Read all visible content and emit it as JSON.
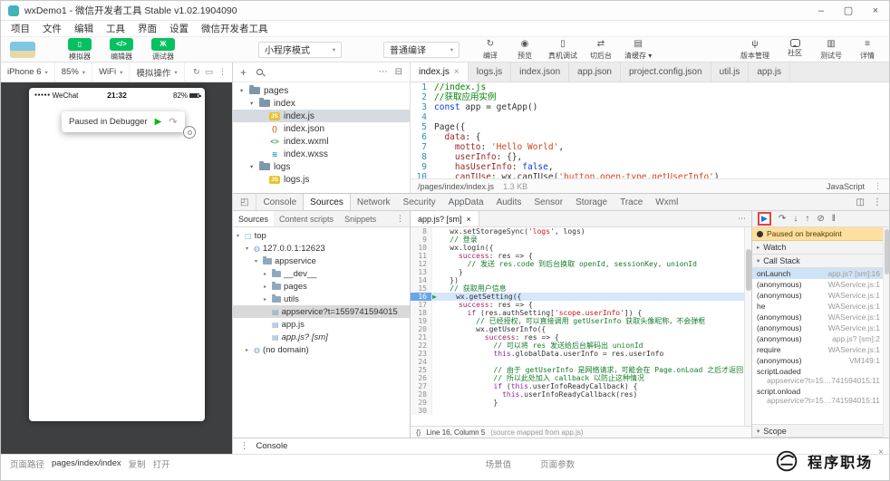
{
  "colors": {
    "wechat_green": "#07c160",
    "devtools_blue": "#1a73e8",
    "annotation_red": "#e04343",
    "paused_banner": "#ffdf9e",
    "selection_blue": "#d6e6fb"
  },
  "window": {
    "title": "wxDemo1 - 微信开发者工具 Stable v1.02.1904090",
    "controls": [
      {
        "name": "minimize-button",
        "glyph": "–"
      },
      {
        "name": "maximize-button",
        "glyph": "▢"
      },
      {
        "name": "close-button",
        "glyph": "×"
      }
    ]
  },
  "menubar": [
    "项目",
    "文件",
    "编辑",
    "工具",
    "界面",
    "设置",
    "微信开发者工具"
  ],
  "toolbar": {
    "modes": [
      {
        "label": "模拟器",
        "icon": "simulator-icon",
        "glyph": "▯"
      },
      {
        "label": "编辑器",
        "icon": "code-icon",
        "glyph": "</>"
      },
      {
        "label": "调试器",
        "icon": "debugger-bug-icon",
        "glyph": "Ж"
      }
    ],
    "mode_select": "小程序模式",
    "compile_select": "普通编译",
    "caret": "▾",
    "actions": [
      {
        "label": "编译",
        "icon": "compile-icon",
        "glyph": "↻"
      },
      {
        "label": "预览",
        "icon": "preview-eye-icon",
        "glyph": "◉"
      },
      {
        "label": "真机调试",
        "icon": "remote-debug-icon",
        "glyph": "▯"
      },
      {
        "label": "切后台",
        "icon": "switch-background-icon",
        "glyph": "⇄"
      },
      {
        "label": "清缓存",
        "icon": "clear-cache-icon",
        "glyph": "▤",
        "dropdown": true
      }
    ],
    "right_actions": [
      {
        "label": "版本管理",
        "icon": "version-control-icon",
        "glyph": "ψ"
      },
      {
        "label": "社区",
        "icon": "community-chat-icon",
        "glyph": "",
        "css": "ico-bubble"
      },
      {
        "label": "测试号",
        "icon": "test-account-icon",
        "glyph": "▥"
      },
      {
        "label": "详情",
        "icon": "details-icon",
        "glyph": "≡"
      }
    ]
  },
  "device_bar": {
    "items": [
      {
        "label": "iPhone 6"
      },
      {
        "label": "85%"
      },
      {
        "label": "WiFi"
      },
      {
        "label": "模拟操作"
      }
    ],
    "caret": "▾",
    "icons": [
      {
        "name": "rotate-icon",
        "glyph": "↻"
      },
      {
        "name": "screenshot-icon",
        "glyph": "▭"
      },
      {
        "name": "more-icon",
        "glyph": "⋮"
      }
    ]
  },
  "simulator": {
    "carrier_dots": "●●●●●",
    "carrier": "WeChat",
    "time": "21:32",
    "battery": "82%",
    "tooltip": {
      "text": "Paused in Debugger",
      "resume_glyph": "▶",
      "step_glyph": "↷"
    }
  },
  "file_explorer": {
    "toolbar_left": [
      {
        "name": "add-file-icon",
        "glyph": "+"
      },
      {
        "name": "search-files-icon",
        "glyph": "",
        "css": "ico-search"
      }
    ],
    "toolbar_right": [
      {
        "name": "more-actions-icon",
        "glyph": "⋯"
      },
      {
        "name": "collapse-all-icon",
        "glyph": "⊟"
      }
    ],
    "tree": [
      {
        "kind": "folder",
        "depth": 0,
        "name": "pages"
      },
      {
        "kind": "folder",
        "depth": 1,
        "name": "index"
      },
      {
        "kind": "file",
        "depth": 2,
        "name": "index.js",
        "badge": "JS",
        "badge_bg": "#e9c231",
        "badge_fg": "#ffffff",
        "selected": true
      },
      {
        "kind": "file",
        "depth": 2,
        "name": "index.json",
        "badge": "{}",
        "badge_fg": "#d68a3a"
      },
      {
        "kind": "file",
        "depth": 2,
        "name": "index.wxml",
        "badge": "<>",
        "badge_fg": "#3a9e63"
      },
      {
        "kind": "file",
        "depth": 2,
        "name": "index.wxss",
        "badge": "≋",
        "badge_fg": "#189ab4"
      },
      {
        "kind": "folder",
        "depth": 1,
        "name": "logs"
      },
      {
        "kind": "file",
        "depth": 2,
        "name": "logs.js",
        "badge": "JS",
        "badge_bg": "#e9c231",
        "badge_fg": "#ffffff"
      }
    ]
  },
  "editor": {
    "tabs": [
      {
        "label": "index.js",
        "active": true,
        "close": "×"
      },
      {
        "label": "logs.js"
      },
      {
        "label": "index.json"
      },
      {
        "label": "app.json"
      },
      {
        "label": "project.config.json"
      },
      {
        "label": "util.js"
      },
      {
        "label": "app.js"
      }
    ],
    "lines": [
      {
        "n": 1,
        "t": [
          [
            "c",
            "//index.js"
          ]
        ]
      },
      {
        "n": 2,
        "t": [
          [
            "c",
            "//获取应用实例"
          ]
        ]
      },
      {
        "n": 3,
        "t": [
          [
            "k",
            "const"
          ],
          [
            "x",
            " app = getApp()"
          ]
        ]
      },
      {
        "n": 4,
        "t": []
      },
      {
        "n": 5,
        "t": [
          [
            "x",
            "Page({"
          ]
        ]
      },
      {
        "n": 6,
        "t": [
          [
            "x",
            "  "
          ],
          [
            "p",
            "data"
          ],
          [
            "x",
            ": {"
          ]
        ]
      },
      {
        "n": 7,
        "t": [
          [
            "x",
            "    "
          ],
          [
            "p",
            "motto"
          ],
          [
            "x",
            ": "
          ],
          [
            "s",
            "'Hello World'"
          ],
          [
            "x",
            ","
          ]
        ]
      },
      {
        "n": 8,
        "t": [
          [
            "x",
            "    "
          ],
          [
            "p",
            "userInfo"
          ],
          [
            "x",
            ": {},"
          ]
        ]
      },
      {
        "n": 9,
        "t": [
          [
            "x",
            "    "
          ],
          [
            "p",
            "hasUserInfo"
          ],
          [
            "x",
            ": "
          ],
          [
            "k",
            "false"
          ],
          [
            "x",
            ","
          ]
        ]
      },
      {
        "n": 10,
        "t": [
          [
            "x",
            "    "
          ],
          [
            "p",
            "canIUse"
          ],
          [
            "x",
            ": wx.canIUse("
          ],
          [
            "s",
            "'button.open-type.getUserInfo'"
          ],
          [
            "x",
            ")"
          ]
        ]
      }
    ],
    "status": {
      "path": "/pages/index/index.js",
      "size": "1.3 KB",
      "language": "JavaScript",
      "menu_glyph": "⋮"
    }
  },
  "devtools": {
    "inspect_glyph": "◰",
    "tabs": [
      {
        "label": "Console"
      },
      {
        "label": "Sources",
        "active": true
      },
      {
        "label": "Network"
      },
      {
        "label": "Security"
      },
      {
        "label": "AppData"
      },
      {
        "label": "Audits"
      },
      {
        "label": "Sensor"
      },
      {
        "label": "Storage"
      },
      {
        "label": "Trace"
      },
      {
        "label": "Wxml"
      }
    ],
    "right_icons": [
      {
        "name": "dock-side-icon",
        "glyph": "◫"
      },
      {
        "name": "devtools-menu-icon",
        "glyph": "⋮"
      }
    ],
    "sources_tabs": [
      {
        "label": "Sources",
        "active": true
      },
      {
        "label": "Content scripts"
      },
      {
        "label": "Snippets"
      }
    ],
    "sources_menu_glyph": "⋮",
    "tree": [
      {
        "depth": 0,
        "arrow": "▾",
        "icon": "frame-icon",
        "glyph": "▢",
        "name": "top"
      },
      {
        "depth": 1,
        "arrow": "▾",
        "icon": "origin-globe-icon",
        "glyph": "◍",
        "name": "127.0.0.1:12623"
      },
      {
        "depth": 2,
        "arrow": "▾",
        "icon": "folder-icon",
        "name": "appservice"
      },
      {
        "depth": 3,
        "arrow": "▸",
        "icon": "folder-icon",
        "name": "__dev__"
      },
      {
        "depth": 3,
        "arrow": "▸",
        "icon": "folder-icon",
        "name": "pages"
      },
      {
        "depth": 3,
        "arrow": "▸",
        "icon": "folder-icon",
        "name": "utils"
      },
      {
        "depth": 3,
        "icon": "file-icon",
        "glyph": "▤",
        "name": "appservice?t=1559741594015",
        "selected": true
      },
      {
        "depth": 3,
        "icon": "file-icon",
        "glyph": "▤",
        "name": "app.js"
      },
      {
        "depth": 3,
        "icon": "file-icon",
        "glyph": "▤",
        "name": "app.js? [sm]",
        "italic": true
      },
      {
        "depth": 1,
        "arrow": "▸",
        "icon": "origin-globe-icon",
        "glyph": "◍",
        "name": "(no domain)"
      }
    ],
    "editor_tab": {
      "label": "app.js? [sm]",
      "close": "×",
      "menu_glyph": "⋯"
    },
    "code_lines": [
      {
        "n": 8,
        "t": [
          [
            "x",
            "    wx.setStorageSync("
          ],
          [
            "s",
            "'logs'"
          ],
          [
            "x",
            ", logs)"
          ]
        ]
      },
      {
        "n": 9,
        "t": [
          [
            "c",
            "    // 登录"
          ]
        ]
      },
      {
        "n": 10,
        "t": [
          [
            "x",
            "    wx.login({"
          ]
        ]
      },
      {
        "n": 11,
        "t": [
          [
            "x",
            "      "
          ],
          [
            "p",
            "success"
          ],
          [
            "x",
            ": res => {"
          ]
        ]
      },
      {
        "n": 12,
        "t": [
          [
            "c",
            "        // 发送 res.code 到后台换取 openId, sessionKey, unionId"
          ]
        ]
      },
      {
        "n": 13,
        "t": [
          [
            "x",
            "      }"
          ]
        ]
      },
      {
        "n": 14,
        "t": [
          [
            "x",
            "    })"
          ]
        ]
      },
      {
        "n": 15,
        "t": [
          [
            "c",
            "    // 获取用户信息"
          ]
        ]
      },
      {
        "n": 16,
        "cur": true,
        "t": [
          [
            "x",
            "    wx.getSetting({"
          ]
        ]
      },
      {
        "n": 17,
        "t": [
          [
            "x",
            "      "
          ],
          [
            "p",
            "success"
          ],
          [
            "x",
            ": res => {"
          ]
        ]
      },
      {
        "n": 18,
        "t": [
          [
            "x",
            "        "
          ],
          [
            "k",
            "if"
          ],
          [
            "x",
            " (res.authSetting["
          ],
          [
            "s",
            "'scope.userInfo'"
          ],
          [
            "x",
            "]) {"
          ]
        ]
      },
      {
        "n": 19,
        "t": [
          [
            "c",
            "          // 已经授权，可以直接调用 getUserInfo 获取头像昵称，不会弹框"
          ]
        ]
      },
      {
        "n": 20,
        "t": [
          [
            "x",
            "          wx.getUserInfo({"
          ]
        ]
      },
      {
        "n": 21,
        "t": [
          [
            "x",
            "            "
          ],
          [
            "p",
            "success"
          ],
          [
            "x",
            ": res => {"
          ]
        ]
      },
      {
        "n": 22,
        "t": [
          [
            "c",
            "              // 可以将 res 发送给后台解码出 unionId"
          ]
        ]
      },
      {
        "n": 23,
        "t": [
          [
            "x",
            "              "
          ],
          [
            "k",
            "this"
          ],
          [
            "x",
            ".globalData.userInfo = res.userInfo"
          ]
        ]
      },
      {
        "n": 24,
        "t": []
      },
      {
        "n": 25,
        "t": [
          [
            "c",
            "              // 由于 getUserInfo 是网络请求，可能会在 Page.onLoad 之后才返回"
          ]
        ]
      },
      {
        "n": 26,
        "t": [
          [
            "c",
            "              // 所以此处加入 callback 以防止这种情况"
          ]
        ]
      },
      {
        "n": 27,
        "t": [
          [
            "x",
            "              "
          ],
          [
            "k",
            "if"
          ],
          [
            "x",
            " ("
          ],
          [
            "k",
            "this"
          ],
          [
            "x",
            ".userInfoReadyCallback) {"
          ]
        ]
      },
      {
        "n": 28,
        "t": [
          [
            "x",
            "                "
          ],
          [
            "k",
            "this"
          ],
          [
            "x",
            ".userInfoReadyCallback(res)"
          ]
        ]
      },
      {
        "n": 29,
        "t": [
          [
            "x",
            "              }"
          ]
        ]
      },
      {
        "n": 30,
        "t": []
      }
    ],
    "code_status": {
      "braces": "{}",
      "line_col": "Line 16, Column 5",
      "mapped": "(source mapped from app.js)"
    },
    "debug": {
      "controls": [
        {
          "name": "resume-icon",
          "glyph": "▶",
          "highlight": true
        },
        {
          "name": "step-over-icon",
          "glyph": "↷"
        },
        {
          "name": "step-into-icon",
          "glyph": "↓"
        },
        {
          "name": "step-out-icon",
          "glyph": "↑"
        },
        {
          "name": "deactivate-breakpoints-icon",
          "glyph": "⊘"
        },
        {
          "name": "pause-on-exceptions-icon",
          "glyph": "‖"
        }
      ],
      "banner": "Paused on breakpoint",
      "watch_label": "Watch",
      "watch_arrow": "▸",
      "call_stack_label": "Call Stack",
      "call_stack_arrow": "▾",
      "scope_label": "Scope",
      "scope_arrow": "▾",
      "call_stack": [
        {
          "fn": "onLaunch",
          "loc": "app.js? [sm]:16",
          "selected": true
        },
        {
          "fn": "(anonymous)",
          "loc": "WAService.js:1"
        },
        {
          "fn": "(anonymous)",
          "loc": "WAService.js:1"
        },
        {
          "fn": "he",
          "loc": "WAService.js:1"
        },
        {
          "fn": "(anonymous)",
          "loc": "WAService.js:1"
        },
        {
          "fn": "(anonymous)",
          "loc": "WAService.js:1"
        },
        {
          "fn": "(anonymous)",
          "loc": "app.js? [sm]:2"
        },
        {
          "fn": "require",
          "loc": "WAService.js:1"
        },
        {
          "fn": "(anonymous)",
          "loc": "VM149:1"
        },
        {
          "fn": "scriptLoaded",
          "loc": "appservice?t=15…741594015:11"
        },
        {
          "fn": "script.onload",
          "loc": "appservice?t=15…741594015:11"
        }
      ]
    },
    "console_drawer": {
      "menu_glyph": "⋮",
      "label": "Console"
    }
  },
  "status_bar": {
    "path_label": "页面路径",
    "path_value": "pages/index/index",
    "copy_label": "复制",
    "open_label": "打开",
    "scene_label": "场景值",
    "params_label": "页面参数"
  },
  "watermark": {
    "text": "程序职场",
    "close": "×"
  }
}
